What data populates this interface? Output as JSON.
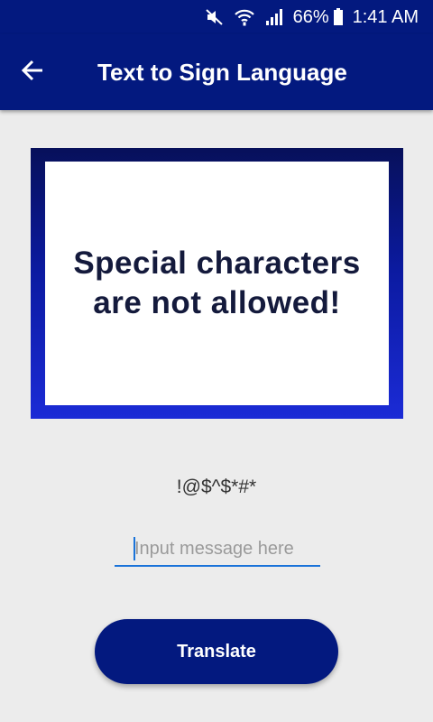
{
  "status_bar": {
    "battery": "66%",
    "time": "1:41 AM",
    "icons": [
      "mute-icon",
      "wifi-icon",
      "signal-icon",
      "battery-icon"
    ]
  },
  "app_bar": {
    "back_icon": "arrow-left-icon",
    "title": "Text to Sign Language"
  },
  "sign_image": {
    "line1": "Special characters",
    "line2": "are not allowed!"
  },
  "echo_text": "!@$^$*#*",
  "input": {
    "value": "",
    "placeholder": "Input message here"
  },
  "translate_button": {
    "label": "Translate"
  },
  "colors": {
    "primary": "#03197f",
    "accent": "#1a73d9",
    "background": "#ececec"
  }
}
